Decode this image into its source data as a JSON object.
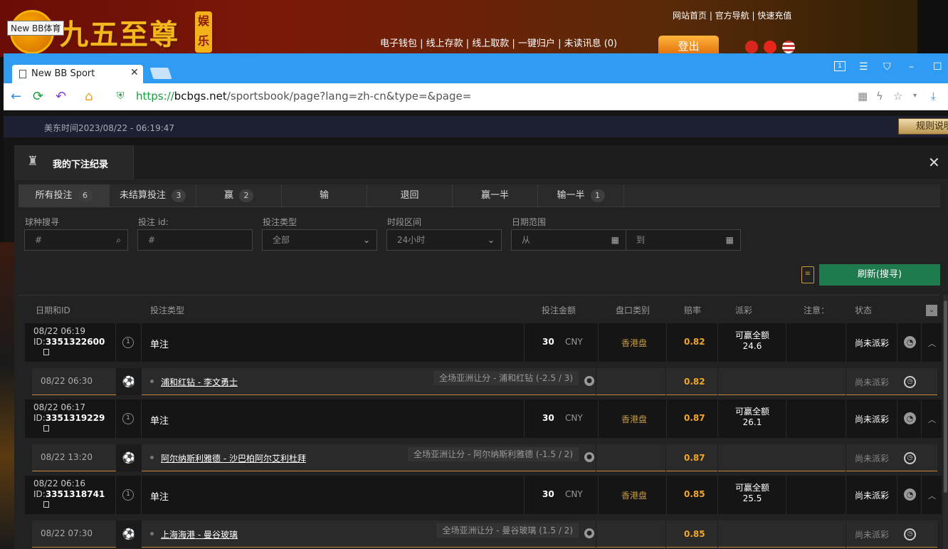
{
  "site": {
    "logo_text": "九五至尊",
    "logo_badge": "娱乐城",
    "tooltip": "New BB体育",
    "toplinks": "网站首页 | 官方导航 | 快速充值",
    "navlinks": "电子钱包 | 线上存款 | 线上取款 | 一键归户 | 未读讯息 (0)",
    "logout": "登出"
  },
  "browser": {
    "tab_title": "New BB Sport",
    "url_scheme": "https://",
    "url_domain": "bcbgs.net",
    "url_path": "/sportsbook/page?lang=zh-cn&type=&page="
  },
  "page": {
    "time": "美东时间2023/08/22 - 06:19:47",
    "rules_button": "规则说明"
  },
  "modal": {
    "title": "我的下注纪录",
    "tabs": [
      {
        "label": "所有投注",
        "count": "6"
      },
      {
        "label": "未结算投注",
        "count": "3"
      },
      {
        "label": "赢",
        "count": "2"
      },
      {
        "label": "输",
        "count": ""
      },
      {
        "label": "退回",
        "count": ""
      },
      {
        "label": "赢一半",
        "count": ""
      },
      {
        "label": "输一半",
        "count": "1"
      }
    ],
    "filters": {
      "sport_label": "球种搜寻",
      "sport_placeholder": "#",
      "id_label": "投注 id:",
      "id_placeholder": "#",
      "type_label": "投注类型",
      "type_value": "全部",
      "period_label": "时段区间",
      "period_value": "24小时",
      "date_label": "日期范围",
      "date_from": "从",
      "date_to": "到"
    },
    "refresh": "刷新(搜寻)",
    "columns": {
      "date_id": "日期和ID",
      "bet_type": "投注类型",
      "amount": "投注金额",
      "odds_type": "盘口类别",
      "odds": "赔率",
      "payout": "派彩",
      "note": "注意：",
      "status": "状态"
    },
    "bets": [
      {
        "date": "08/22 06:19",
        "id_prefix": "ID:",
        "id": "3351322600",
        "type": "单注",
        "amount": "30",
        "currency": "CNY",
        "odds_type": "香港盘",
        "odds": "0.82",
        "payout_label": "可赢全额",
        "payout_value": "24.6",
        "status": "尚未派彩",
        "detail": {
          "time": "08/22 06:30",
          "match": "浦和红钻 - 李文勇士",
          "market": "全场亚洲让分 - 浦和红钻 (-2.5 / 3)",
          "odds": "0.82",
          "status": "尚未派彩"
        }
      },
      {
        "date": "08/22 06:17",
        "id_prefix": "ID:",
        "id": "3351319229",
        "type": "单注",
        "amount": "30",
        "currency": "CNY",
        "odds_type": "香港盘",
        "odds": "0.87",
        "payout_label": "可赢全额",
        "payout_value": "26.1",
        "status": "尚未派彩",
        "detail": {
          "time": "08/22 13:20",
          "match": "阿尔纳斯利雅德 - 沙巴柏阿尔艾利杜拜",
          "market": "全场亚洲让分 - 阿尔纳斯利雅德 (-1.5 / 2)",
          "odds": "0.87",
          "status": "尚未派彩"
        }
      },
      {
        "date": "08/22 06:16",
        "id_prefix": "ID:",
        "id": "3351318741",
        "type": "单注",
        "amount": "30",
        "currency": "CNY",
        "odds_type": "香港盘",
        "odds": "0.85",
        "payout_label": "可赢全额",
        "payout_value": "25.5",
        "status": "尚未派彩",
        "detail": {
          "time": "08/22 07:30",
          "match": "上海海港 - 曼谷玻璃",
          "market": "全场亚洲让分 - 曼谷玻璃 (1.5 / 2)",
          "odds": "0.85",
          "status": "尚未派彩"
        }
      }
    ]
  }
}
